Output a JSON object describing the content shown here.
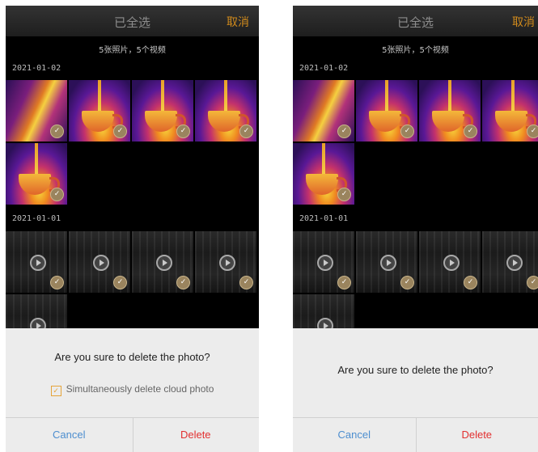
{
  "left": {
    "header": {
      "title": "已全选",
      "cancel": "取消"
    },
    "count_text": "5张照片，5个视频",
    "groups": [
      {
        "date": "2021-01-02"
      },
      {
        "date": "2021-01-01"
      }
    ],
    "dialog": {
      "question": "Are you sure to delete the photo?",
      "cloud_checkbox_label": "Simultaneously delete cloud photo",
      "cloud_checkbox_checked": true,
      "cancel": "Cancel",
      "delete": "Delete"
    }
  },
  "right": {
    "header": {
      "title": "已全选",
      "cancel": "取消"
    },
    "count_text": "5张照片，5个视频",
    "groups": [
      {
        "date": "2021-01-02"
      },
      {
        "date": "2021-01-01"
      }
    ],
    "dialog": {
      "question": "Are you sure to delete the photo?",
      "cancel": "Cancel",
      "delete": "Delete"
    }
  },
  "colors": {
    "accent": "#d08a1c",
    "cancel_blue": "#4d8ecf",
    "delete_red": "#e23030"
  },
  "icons": {
    "check": "check-icon",
    "play": "play-icon"
  }
}
